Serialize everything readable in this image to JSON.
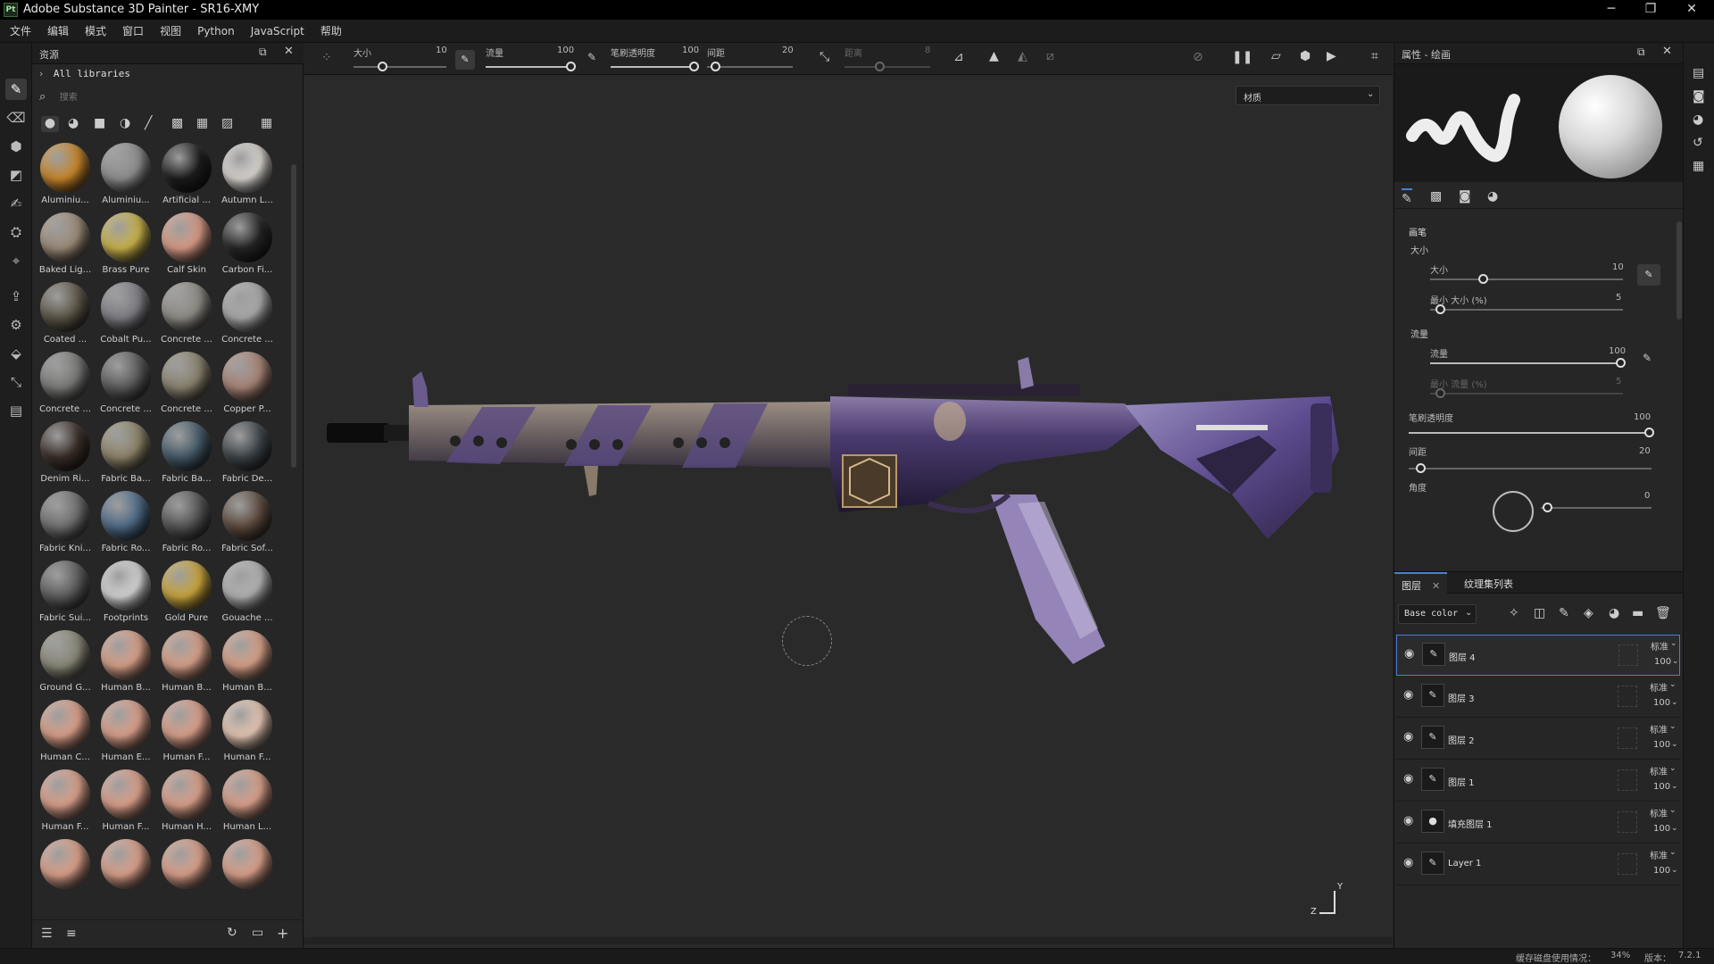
{
  "window": {
    "title": "Adobe Substance 3D Painter - SR16-XMY",
    "logo": "Pt"
  },
  "menu": [
    "文件",
    "编辑",
    "模式",
    "窗口",
    "视图",
    "Python",
    "JavaScript",
    "帮助"
  ],
  "assets": {
    "title": "资源",
    "breadcrumb": "All libraries",
    "search_placeholder": "搜索",
    "items": [
      {
        "label": "Aluminiu...",
        "color": "#c8862a"
      },
      {
        "label": "Aluminiu...",
        "color": "#8e8e8e"
      },
      {
        "label": "Artificial ...",
        "color": "#1c1c1c"
      },
      {
        "label": "Autumn L...",
        "color": "#d9d4cf"
      },
      {
        "label": "Baked Lig...",
        "color": "#9c8b78"
      },
      {
        "label": "Brass Pure",
        "color": "#c9b24a"
      },
      {
        "label": "Calf Skin",
        "color": "#d89a84"
      },
      {
        "label": "Carbon Fi...",
        "color": "#252525"
      },
      {
        "label": "Coated ...",
        "color": "#5d5648"
      },
      {
        "label": "Cobalt Pu...",
        "color": "#7e7e84"
      },
      {
        "label": "Concrete ...",
        "color": "#8e8b84"
      },
      {
        "label": "Concrete ...",
        "color": "#a9a9a9"
      },
      {
        "label": "Concrete ...",
        "color": "#7a7a78"
      },
      {
        "label": "Concrete ...",
        "color": "#5c5c5c"
      },
      {
        "label": "Concrete ...",
        "color": "#8a826f"
      },
      {
        "label": "Copper P...",
        "color": "#a88476"
      },
      {
        "label": "Denim Ri...",
        "color": "#3a2e28"
      },
      {
        "label": "Fabric Ba...",
        "color": "#8e8469"
      },
      {
        "label": "Fabric Ba...",
        "color": "#455a68"
      },
      {
        "label": "Fabric De...",
        "color": "#3c4348"
      },
      {
        "label": "Fabric Kni...",
        "color": "#707070"
      },
      {
        "label": "Fabric Ro...",
        "color": "#4e6a86"
      },
      {
        "label": "Fabric Ro...",
        "color": "#555555"
      },
      {
        "label": "Fabric Sof...",
        "color": "#5d4a3e"
      },
      {
        "label": "Fabric Sui...",
        "color": "#5e5e5e"
      },
      {
        "label": "Footprints",
        "color": "#d4d4d4"
      },
      {
        "label": "Gold Pure",
        "color": "#c9a53c"
      },
      {
        "label": "Gouache ...",
        "color": "#b3b3b3"
      },
      {
        "label": "Ground G...",
        "color": "#8a8878"
      },
      {
        "label": "Human B...",
        "color": "#d8a088"
      },
      {
        "label": "Human B...",
        "color": "#d8a088"
      },
      {
        "label": "Human B...",
        "color": "#d8a088"
      },
      {
        "label": "Human C...",
        "color": "#dba08a"
      },
      {
        "label": "Human E...",
        "color": "#dba08a"
      },
      {
        "label": "Human F...",
        "color": "#dba08a"
      },
      {
        "label": "Human F...",
        "color": "#e6c7b4"
      },
      {
        "label": "Human F...",
        "color": "#dba08a"
      },
      {
        "label": "Human F...",
        "color": "#dba08a"
      },
      {
        "label": "Human H...",
        "color": "#dba08a"
      },
      {
        "label": "Human L...",
        "color": "#dba08a"
      },
      {
        "label": "",
        "color": "#dba08a"
      },
      {
        "label": "",
        "color": "#dba08a"
      },
      {
        "label": "",
        "color": "#dba08a"
      },
      {
        "label": "",
        "color": "#dba08a"
      }
    ]
  },
  "toolbar": {
    "size_label": "大小",
    "size_value": "10",
    "flow_label": "流量",
    "flow_value": "100",
    "opacity_label": "笔刷透明度",
    "opacity_value": "100",
    "spacing_label": "间距",
    "spacing_value": "20",
    "dist_label": "距离",
    "dist_value": "8"
  },
  "viewport": {
    "channel_select": "材质",
    "axis_y": "Y",
    "axis_z": "Z"
  },
  "properties": {
    "title": "属性 - 绘画",
    "section_brush": "画笔",
    "sub_size": "大小",
    "size_label": "大小",
    "size_value": "10",
    "min_size_label": "最小 大小 (%)",
    "min_size_value": "5",
    "section_flow": "流量",
    "flow_label": "流量",
    "flow_value": "100",
    "min_flow_label": "最小 流量 (%)",
    "min_flow_value": "5",
    "opacity_label": "笔刷透明度",
    "opacity_value": "100",
    "spacing_label": "间距",
    "spacing_value": "20",
    "angle_label": "角度",
    "angle_value": "0"
  },
  "layers_panel": {
    "tab_layers": "图层",
    "tab_texture": "纹理集列表",
    "channel": "Base color",
    "rows": [
      {
        "name": "图层 4",
        "blend": "标准",
        "opacity": "100",
        "type": "paint"
      },
      {
        "name": "图层 3",
        "blend": "标准",
        "opacity": "100",
        "type": "paint"
      },
      {
        "name": "图层 2",
        "blend": "标准",
        "opacity": "100",
        "type": "paint"
      },
      {
        "name": "图层 1",
        "blend": "标准",
        "opacity": "100",
        "type": "paint"
      },
      {
        "name": "填充图层 1",
        "blend": "标准",
        "opacity": "100",
        "type": "fill"
      },
      {
        "name": "Layer 1",
        "blend": "标准",
        "opacity": "100",
        "type": "paint"
      }
    ]
  },
  "status": {
    "disk_label": "缓存磁盘使用情况：",
    "disk_value": "34%",
    "version_label": "版本：",
    "version_value": "7.2.1"
  }
}
